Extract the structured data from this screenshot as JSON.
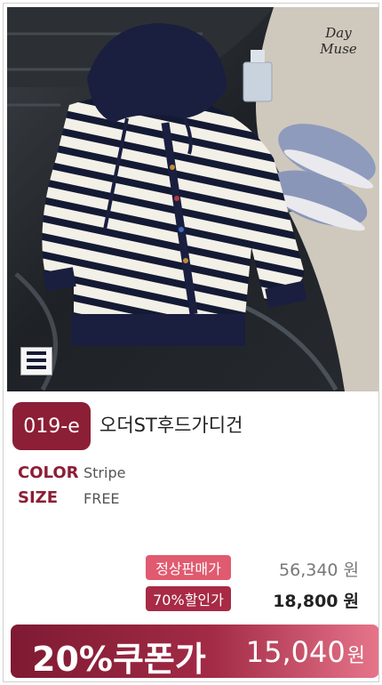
{
  "product": {
    "code": "019-e",
    "name": "오더ST후드가디건",
    "watermark": "Day Muse"
  },
  "options": [
    {
      "label": "COLOR",
      "value": "Stripe"
    },
    {
      "label": "SIZE",
      "value": "FREE"
    }
  ],
  "prices": {
    "regular_label": "정상판매가",
    "regular_price": "56,340",
    "sale_label": "70%할인가",
    "sale_price": "18,800",
    "currency": "원"
  },
  "coupon": {
    "label": "20%쿠폰가",
    "price": "15,040",
    "currency": "원"
  },
  "colors": {
    "accent": "#8c1e35",
    "pill_regular": "#e05a70",
    "pill_sale": "#a82a45"
  }
}
